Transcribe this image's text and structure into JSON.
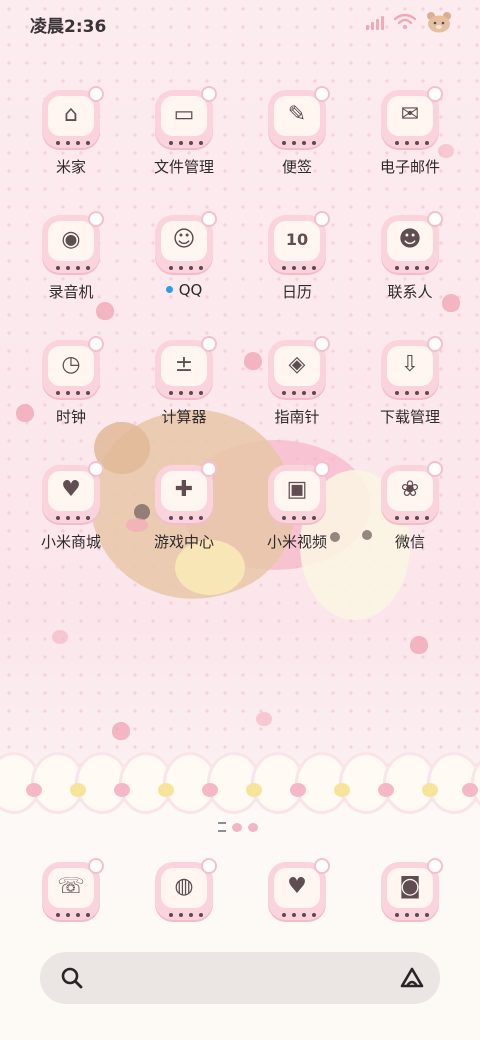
{
  "status_bar": {
    "time": "凌晨2:36",
    "signal_icon": "signal-bars-icon",
    "wifi_icon": "wifi-icon",
    "battery_icon": "bear-battery-icon"
  },
  "apps": [
    {
      "label": "米家",
      "icon": "house-icon",
      "glyph": "⌂"
    },
    {
      "label": "文件管理",
      "icon": "folder-icon",
      "glyph": "▭"
    },
    {
      "label": "便签",
      "icon": "notebook-pen-icon",
      "glyph": "✎"
    },
    {
      "label": "电子邮件",
      "icon": "mail-icon",
      "glyph": "✉"
    },
    {
      "label": "录音机",
      "icon": "recorder-icon",
      "glyph": "◉"
    },
    {
      "label": "QQ",
      "icon": "penguin-icon",
      "glyph": "☺",
      "has_new_dot": true
    },
    {
      "label": "日历",
      "icon": "calendar-icon",
      "glyph": "10"
    },
    {
      "label": "联系人",
      "icon": "contacts-icon",
      "glyph": "☻"
    },
    {
      "label": "时钟",
      "icon": "clock-icon",
      "glyph": "◷"
    },
    {
      "label": "计算器",
      "icon": "calculator-icon",
      "glyph": "±"
    },
    {
      "label": "指南针",
      "icon": "compass-icon",
      "glyph": "◈"
    },
    {
      "label": "下载管理",
      "icon": "download-icon",
      "glyph": "⇩"
    },
    {
      "label": "小米商城",
      "icon": "shop-icon",
      "glyph": "♥"
    },
    {
      "label": "游戏中心",
      "icon": "gamepad-icon",
      "glyph": "✚"
    },
    {
      "label": "小米视频",
      "icon": "tv-icon",
      "glyph": "▣"
    },
    {
      "label": "微信",
      "icon": "bunny-chat-icon",
      "glyph": "❀"
    }
  ],
  "dock": [
    {
      "icon": "phone-icon",
      "glyph": "☏"
    },
    {
      "icon": "browser-globe-icon",
      "glyph": "◍"
    },
    {
      "icon": "messages-icon",
      "glyph": "♥"
    },
    {
      "icon": "camera-icon",
      "glyph": "◙"
    }
  ],
  "search_bar": {
    "search_icon": "search-icon",
    "assistant_icon": "assistant-icon"
  },
  "colors": {
    "tile": "#fbd3dd",
    "accent_pink": "#f1a9b8",
    "new_dot": "#2b9bea"
  }
}
